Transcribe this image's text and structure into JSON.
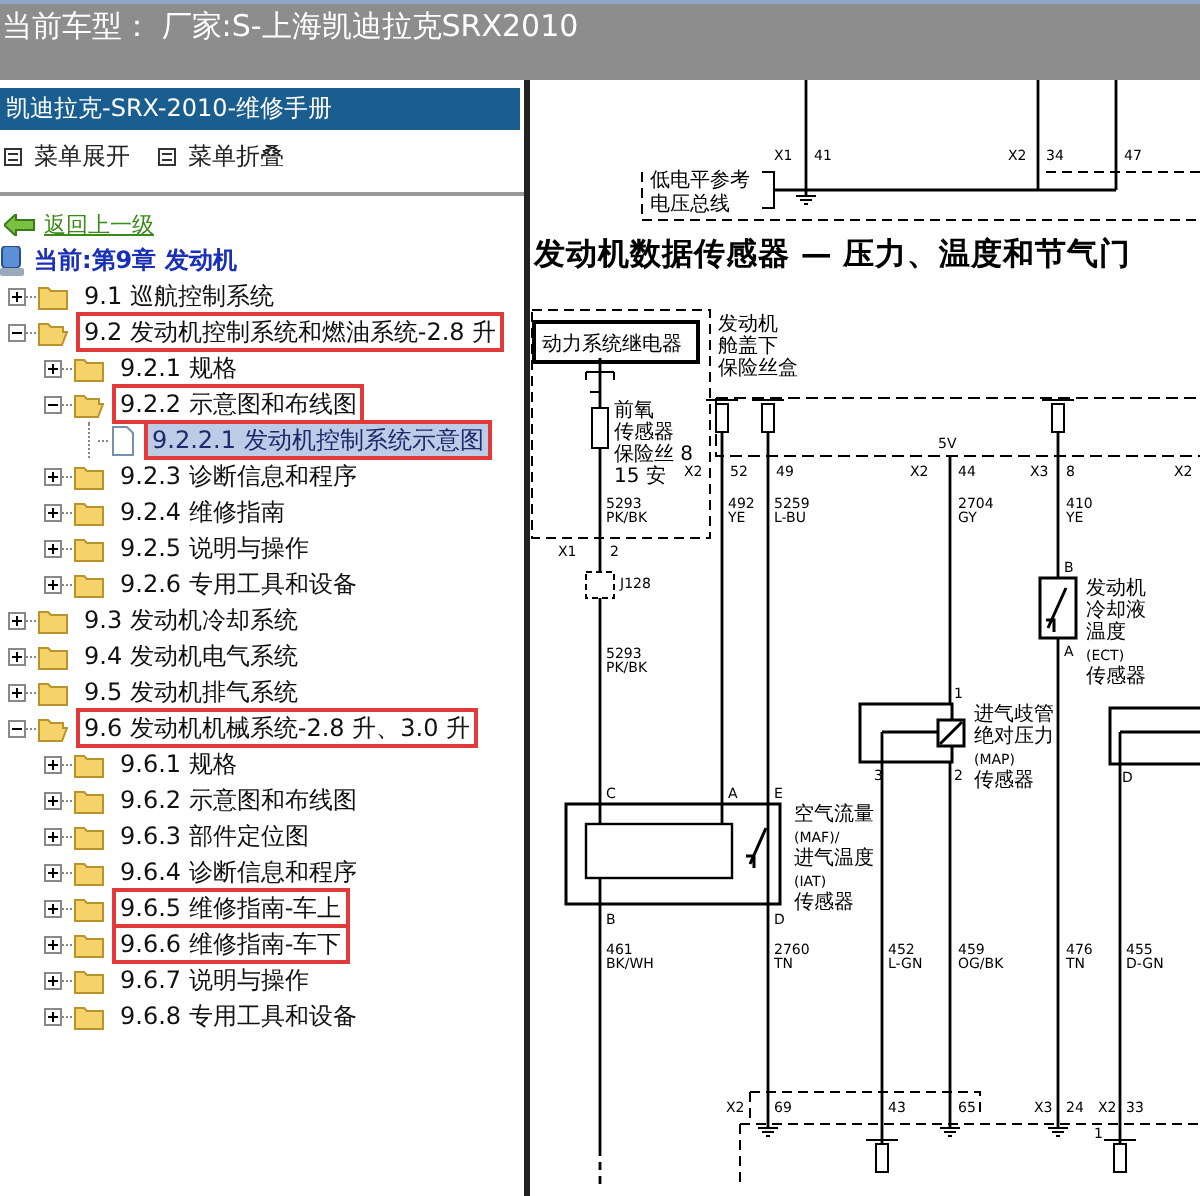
{
  "title_bar": {
    "label": "当前车型：",
    "value": "厂家:S-上海凯迪拉克SRX2010"
  },
  "sidebar": {
    "title": "凯迪拉克-SRX-2010-维修手册",
    "menu": [
      "菜单展开",
      "菜单折叠"
    ],
    "back_link": "返回上一级",
    "current": "当前:第9章 发动机",
    "tree": [
      {
        "label": "9.1 巡航控制系统",
        "kind": "folder",
        "expanded": false,
        "selected": false,
        "highlighted": false
      },
      {
        "label": "9.2 发动机控制系统和燃油系统-2.8 升",
        "kind": "folder",
        "expanded": true,
        "selected": false,
        "highlighted": true,
        "children": [
          {
            "label": "9.2.1 规格",
            "kind": "folder",
            "expanded": false,
            "selected": false,
            "highlighted": false
          },
          {
            "label": "9.2.2 示意图和布线图",
            "kind": "folder",
            "expanded": true,
            "selected": false,
            "highlighted": true,
            "children": [
              {
                "label": "9.2.2.1 发动机控制系统示意图",
                "kind": "page",
                "selected": true,
                "highlighted": true
              }
            ]
          },
          {
            "label": "9.2.3 诊断信息和程序",
            "kind": "folder",
            "expanded": false,
            "selected": false,
            "highlighted": false
          },
          {
            "label": "9.2.4 维修指南",
            "kind": "folder",
            "expanded": false,
            "selected": false,
            "highlighted": false
          },
          {
            "label": "9.2.5 说明与操作",
            "kind": "folder",
            "expanded": false,
            "selected": false,
            "highlighted": false
          },
          {
            "label": "9.2.6 专用工具和设备",
            "kind": "folder",
            "expanded": false,
            "selected": false,
            "highlighted": false
          }
        ]
      },
      {
        "label": "9.3 发动机冷却系统",
        "kind": "folder",
        "expanded": false,
        "selected": false,
        "highlighted": false
      },
      {
        "label": "9.4 发动机电气系统",
        "kind": "folder",
        "expanded": false,
        "selected": false,
        "highlighted": false
      },
      {
        "label": "9.5 发动机排气系统",
        "kind": "folder",
        "expanded": false,
        "selected": false,
        "highlighted": false
      },
      {
        "label": "9.6 发动机机械系统-2.8 升、3.0 升",
        "kind": "folder",
        "expanded": true,
        "selected": false,
        "highlighted": true,
        "children": [
          {
            "label": "9.6.1 规格",
            "kind": "folder",
            "expanded": false,
            "selected": false,
            "highlighted": false
          },
          {
            "label": "9.6.2 示意图和布线图",
            "kind": "folder",
            "expanded": false,
            "selected": false,
            "highlighted": false
          },
          {
            "label": "9.6.3 部件定位图",
            "kind": "folder",
            "expanded": false,
            "selected": false,
            "highlighted": false
          },
          {
            "label": "9.6.4 诊断信息和程序",
            "kind": "folder",
            "expanded": false,
            "selected": false,
            "highlighted": false
          },
          {
            "label": "9.6.5 维修指南-车上",
            "kind": "folder",
            "expanded": false,
            "selected": false,
            "highlighted": true
          },
          {
            "label": "9.6.6 维修指南-车下",
            "kind": "folder",
            "expanded": false,
            "selected": false,
            "highlighted": true
          },
          {
            "label": "9.6.7 说明与操作",
            "kind": "folder",
            "expanded": false,
            "selected": false,
            "highlighted": false
          },
          {
            "label": "9.6.8 专用工具和设备",
            "kind": "folder",
            "expanded": false,
            "selected": false,
            "highlighted": false
          }
        ]
      }
    ]
  },
  "document": {
    "heading": "发动机数据传感器 — 压力、温度和节气门",
    "upper_labels": [
      "X1",
      "41",
      "X2",
      "34",
      "47",
      "低电平参考",
      "电压总线"
    ],
    "lower_labels": [
      "动力系统继电器",
      "发动机",
      "舱盖下",
      "保险丝盒",
      "前氧",
      "传感器",
      "保险丝 8",
      "15 安",
      "X1",
      "2",
      "X2",
      "52",
      "49",
      "5V",
      "X2",
      "44",
      "X3",
      "8",
      "X2",
      "5293",
      "PK/BK",
      "492",
      "YE",
      "5259",
      "L-BU",
      "2704",
      "GY",
      "410",
      "YE",
      "J128",
      "5293",
      "PK/BK",
      "B",
      "A",
      "发动机",
      "冷却液",
      "温度",
      "(ECT)",
      "传感器",
      "1",
      "3",
      "2",
      "进气歧管",
      "绝对压力",
      "(MAP)",
      "传感器",
      "D",
      "C",
      "A",
      "E",
      "B",
      "D",
      "空气流量",
      "(MAF)/",
      "进气温度",
      "(IAT)",
      "传感器",
      "461",
      "BK/WH",
      "2760",
      "TN",
      "452",
      "L-GN",
      "459",
      "OG/BK",
      "476",
      "TN",
      "455",
      "D-GN",
      "X2",
      "69",
      "43",
      "65",
      "X3",
      "24",
      "X2",
      "33",
      "1"
    ]
  }
}
